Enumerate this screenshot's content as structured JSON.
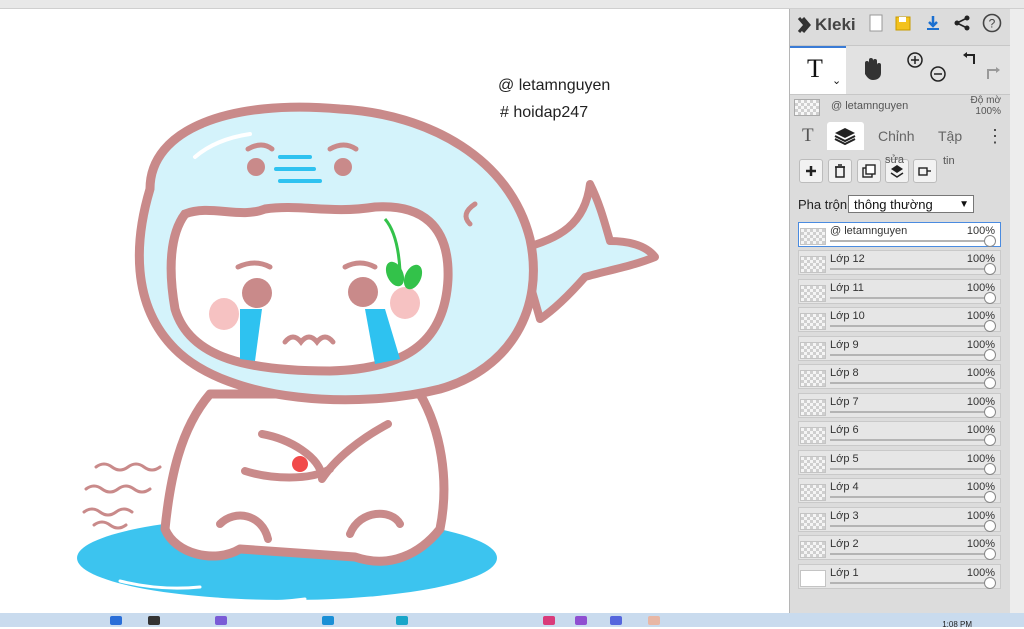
{
  "app": {
    "name": "Kleki",
    "brand_color": "#3a7bd5",
    "header_icons": [
      "new-file-icon",
      "save-icon",
      "download-icon",
      "share-icon",
      "help-icon"
    ]
  },
  "canvas": {
    "watermark_line1": "@ letamnguyen",
    "watermark_line2": "# hoidap247"
  },
  "tools": [
    "text-tool",
    "hand-tool",
    "zoom-in-icon",
    "zoom-out-icon",
    "undo-icon",
    "redo-icon"
  ],
  "brush": {
    "name": "@ letamnguyen",
    "opacity_label": "Độ mờ",
    "opacity_value": "100%"
  },
  "tabs": {
    "text_glyph": "T",
    "adjust": "Chỉnh",
    "file": "Tập",
    "more": "⋮"
  },
  "layer_actions": {
    "edit_label": "sửa",
    "info_label": "tin"
  },
  "blend": {
    "label": "Pha trộn",
    "value": "thông thường"
  },
  "layers": [
    {
      "name": "@ letamnguyen",
      "opacity": "100%",
      "selected": true
    },
    {
      "name": "Lớp 12",
      "opacity": "100%"
    },
    {
      "name": "Lớp 11",
      "opacity": "100%"
    },
    {
      "name": "Lớp 10",
      "opacity": "100%"
    },
    {
      "name": "Lớp 9",
      "opacity": "100%"
    },
    {
      "name": "Lớp 8",
      "opacity": "100%"
    },
    {
      "name": "Lớp 7",
      "opacity": "100%"
    },
    {
      "name": "Lớp 6",
      "opacity": "100%"
    },
    {
      "name": "Lớp 5",
      "opacity": "100%"
    },
    {
      "name": "Lớp 4",
      "opacity": "100%"
    },
    {
      "name": "Lớp 3",
      "opacity": "100%"
    },
    {
      "name": "Lớp 2",
      "opacity": "100%"
    },
    {
      "name": "Lớp 1",
      "opacity": "100%"
    }
  ],
  "taskbar": {
    "clock": "1:08 PM"
  },
  "colors": {
    "outline": "#c98a8a",
    "bubble": "#d4f3fb",
    "tears": "#2ec2f0",
    "puddle": "#3cc4ef",
    "cheek": "#f6c2c2",
    "leaf": "#33c24a"
  }
}
